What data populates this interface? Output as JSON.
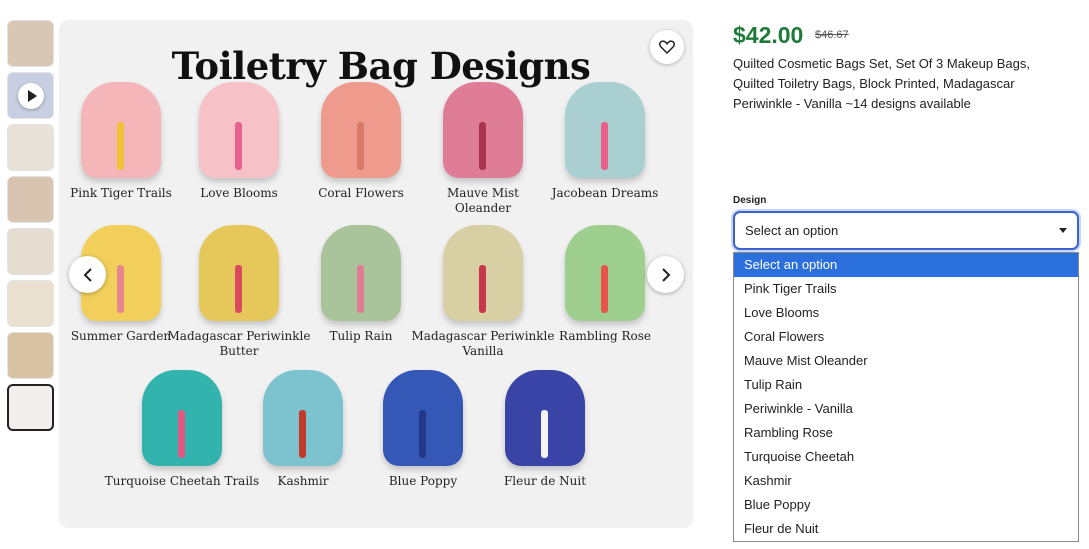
{
  "hero": {
    "title": "Toiletry Bag Designs",
    "bags": [
      {
        "label": "Pink Tiger Trails",
        "color": "#f4b6b8",
        "tassel": "#f0c23a"
      },
      {
        "label": "Love Blooms",
        "color": "#f6c2c8",
        "tassel": "#e8628e"
      },
      {
        "label": "Coral Flowers",
        "color": "#ee9a8c",
        "tassel": "#d97a6a"
      },
      {
        "label": "Mauve Mist\nOleander",
        "color": "#df7d97",
        "tassel": "#a9344e"
      },
      {
        "label": "Jacobean Dreams",
        "color": "#a9cfd0",
        "tassel": "#e8608a"
      },
      {
        "label": "Summer Garden",
        "color": "#f1cf5a",
        "tassel": "#e7868f"
      },
      {
        "label": "Madagascar Periwinkle\nButter",
        "color": "#e6c85a",
        "tassel": "#d94b5c"
      },
      {
        "label": "Tulip Rain",
        "color": "#a9c39a",
        "tassel": "#e27b94"
      },
      {
        "label": "Madagascar Periwinkle\nVanilla",
        "color": "#d9cfa4",
        "tassel": "#c9374d"
      },
      {
        "label": "Rambling Rose",
        "color": "#9fcf8e",
        "tassel": "#e7554a"
      },
      {
        "label": "Turquoise Cheetah Trails",
        "color": "#32b3ae",
        "tassel": "#e05780"
      },
      {
        "label": "Kashmir",
        "color": "#7cc3cf",
        "tassel": "#c33a2c"
      },
      {
        "label": "Blue Poppy",
        "color": "#3558b6",
        "tassel": "#22398a"
      },
      {
        "label": "Fleur de Nuit",
        "color": "#3a43a6",
        "tassel": "#f4f4f4"
      }
    ]
  },
  "thumbs": [
    {
      "color": "#d9c7b6"
    },
    {
      "color": "#c8cfe2",
      "video": true
    },
    {
      "color": "#e7e1d7"
    },
    {
      "color": "#d8c4b0"
    },
    {
      "color": "#e4ddd0"
    },
    {
      "color": "#e9e0d0"
    },
    {
      "color": "#d7c2a3"
    },
    {
      "color": "#f2eeee",
      "selected": true
    }
  ],
  "product": {
    "price": "$42.00",
    "old_price": "$46.67",
    "title": "Quilted Cosmetic Bags Set, Set Of 3 Makeup Bags, Quilted Toiletry Bags, Block Printed, Madagascar Periwinkle - Vanilla ~14 designs available"
  },
  "design": {
    "label": "Design",
    "selected": "Select an option",
    "options": [
      "Select an option",
      "Pink Tiger Trails",
      "Love Blooms",
      "Coral Flowers",
      "Mauve Mist Oleander",
      "Tulip Rain",
      "Periwinkle - Vanilla",
      "Rambling Rose",
      "Turquoise Cheetah",
      "Kashmir",
      "Blue Poppy",
      "Fleur de Nuit"
    ]
  },
  "icons": {
    "favorite": "heart-icon",
    "prev": "chevron-left-icon",
    "next": "chevron-right-icon",
    "select_caret": "caret-down-icon"
  }
}
